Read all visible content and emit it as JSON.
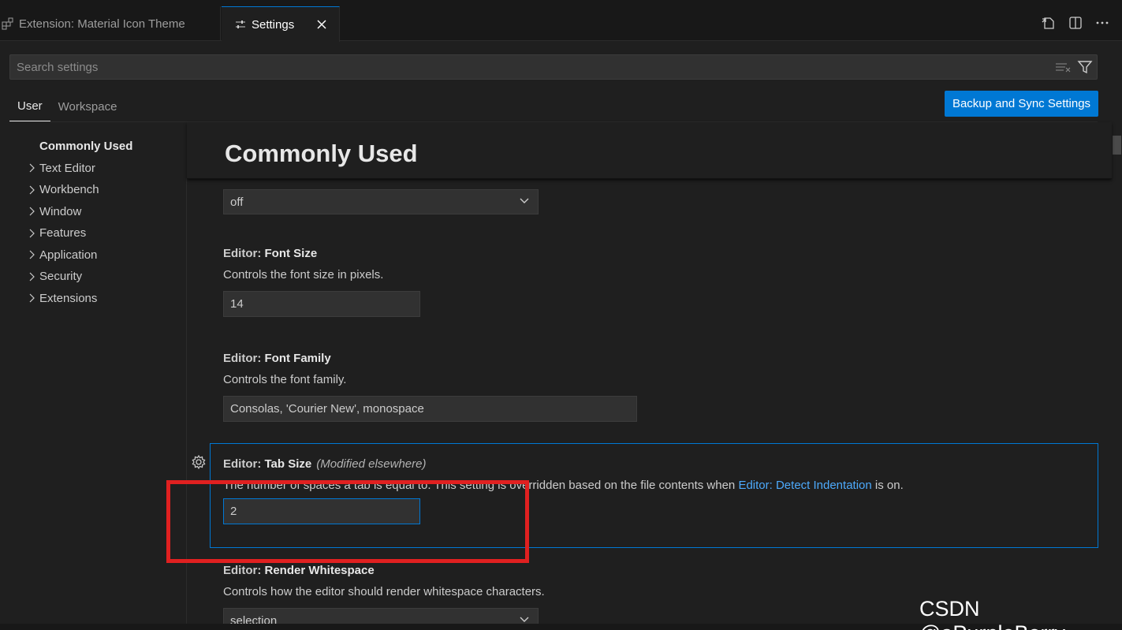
{
  "tabs": {
    "extension_label": "Extension: Material Icon Theme",
    "settings_label": "Settings"
  },
  "search": {
    "placeholder": "Search settings"
  },
  "scope": {
    "user": "User",
    "workspace": "Workspace",
    "sync_button": "Backup and Sync Settings"
  },
  "toc": {
    "active": "Commonly Used",
    "items": [
      "Text Editor",
      "Workbench",
      "Window",
      "Features",
      "Application",
      "Security",
      "Extensions"
    ]
  },
  "content": {
    "title": "Commonly Used",
    "select_value": "off",
    "font_size": {
      "category": "Editor: ",
      "name": "Font Size",
      "description": "Controls the font size in pixels.",
      "value": "14"
    },
    "font_family": {
      "category": "Editor: ",
      "name": "Font Family",
      "description": "Controls the font family.",
      "value": "Consolas, 'Courier New', monospace"
    },
    "tab_size": {
      "category": "Editor: ",
      "name": "Tab Size",
      "modified": "(Modified elsewhere)",
      "description_before": "The number of spaces a tab is equal to. This setting is overridden based on the file contents when ",
      "description_link": "Editor: Detect Indentation",
      "description_after": " is on.",
      "value": "2"
    },
    "render_whitespace": {
      "category": "Editor: ",
      "name": "Render Whitespace",
      "description": "Controls how the editor should render whitespace characters.",
      "value": "selection"
    }
  },
  "watermark": "CSDN @aPurpleBerry",
  "colors": {
    "accent": "#0078d4",
    "link": "#4daafc",
    "annotation": "#e02020"
  }
}
